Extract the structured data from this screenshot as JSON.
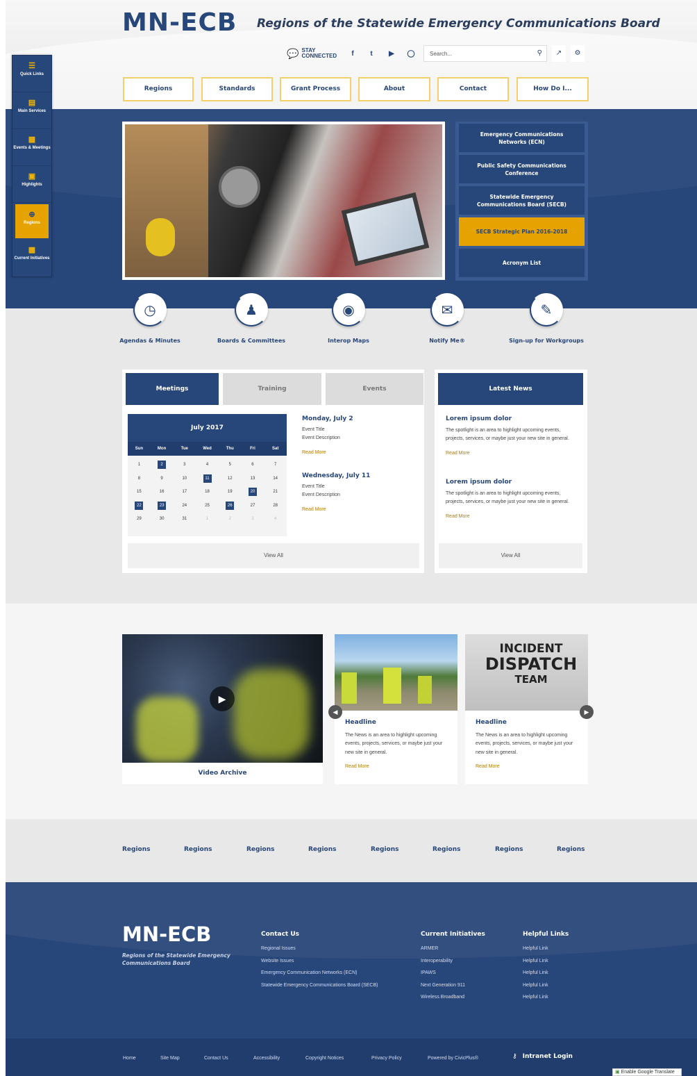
{
  "header": {
    "logo": "MN-ECB",
    "tagline": "Regions of the Statewide Emergency Communications Board",
    "stay_connected": [
      "STAY",
      "CONNECTED"
    ],
    "social": [
      "facebook-icon",
      "twitter-icon",
      "youtube-icon",
      "instagram-icon"
    ],
    "search_placeholder": "Search...",
    "nav": [
      "Regions",
      "Standards",
      "Grant Process",
      "About",
      "Contact",
      "How Do I..."
    ]
  },
  "sidebar": {
    "items": [
      {
        "label": "Quick Links",
        "icon": "list-icon"
      },
      {
        "label": "Main Services",
        "icon": "document-icon"
      },
      {
        "label": "Events & Meetings",
        "icon": "calendar-icon"
      },
      {
        "label": "Highlights",
        "icon": "image-icon"
      },
      {
        "label": "Regions",
        "icon": "globe-icon"
      },
      {
        "label": "Current Initiatives",
        "icon": "presentation-icon"
      }
    ]
  },
  "quick_links": [
    "Emergency Communications Networks (ECN)",
    "Public Safety Communications Conference",
    "Statewide Emergency Communications Board (SECB)",
    "SECB Strategic Plan 2016-2018",
    "Acronym List"
  ],
  "icon_links": [
    {
      "label": "Agendas & Minutes",
      "icon": "clock-icon"
    },
    {
      "label": "Boards & Committees",
      "icon": "people-icon"
    },
    {
      "label": "Interop Maps",
      "icon": "map-pin-icon"
    },
    {
      "label": "Notify Me®",
      "icon": "envelope-icon"
    },
    {
      "label": "Sign-up for Workgroups",
      "icon": "edit-icon"
    }
  ],
  "calendar": {
    "tabs": [
      "Meetings",
      "Training",
      "Events"
    ],
    "month": "July 2017",
    "weekdays": [
      "Sun",
      "Mon",
      "Tue",
      "Wed",
      "Thu",
      "Fri",
      "Sat"
    ],
    "weeks": [
      [
        "",
        "",
        "",
        "",
        "",
        "",
        ""
      ],
      [
        "1",
        "2",
        "3",
        "4",
        "5",
        "6",
        "7"
      ],
      [
        "8",
        "9",
        "10",
        "11",
        "12",
        "13",
        "14"
      ],
      [
        "15",
        "16",
        "17",
        "18",
        "19",
        "20",
        "21"
      ],
      [
        "22",
        "23",
        "24",
        "25",
        "26",
        "27",
        "28"
      ],
      [
        "29",
        "30",
        "31",
        "1",
        "2",
        "3",
        "4"
      ]
    ],
    "events": [
      {
        "date": "Monday, July 2",
        "title": "Event Title",
        "desc": "Event Description",
        "more": "Read More"
      },
      {
        "date": "Wednesday, July 11",
        "title": "Event Title",
        "desc": "Event Description",
        "more": "Read More"
      }
    ],
    "view_all": "View All"
  },
  "news": {
    "title": "Latest News",
    "items": [
      {
        "headline": "Lorem ipsum dolor",
        "text": "The spotlight is an area to highlight upcoming events, projects, services, or maybe just your new site in general.",
        "more": "Read More"
      },
      {
        "headline": "Lorem ipsum dolor",
        "text": "The spotlight is an area to highlight upcoming events, projects, services, or maybe just your new site in general.",
        "more": "Read More"
      }
    ],
    "view_all": "View All"
  },
  "media": {
    "video_label": "Video Archive",
    "cards": [
      {
        "headline": "Headline",
        "text": "The News is an area to highlight upcoming events, projects, services, or maybe just your new site in general.",
        "more": "Read More"
      },
      {
        "headline": "Headline",
        "text": "The News is an area to highlight upcoming events, projects, services, or maybe just your new site in general.",
        "more": "Read More",
        "image_text": [
          "INCIDENT",
          "DISPATCH",
          "TEAM"
        ]
      }
    ]
  },
  "regions": [
    "Regions",
    "Regions",
    "Regions",
    "Regions",
    "Regions",
    "Regions",
    "Regions",
    "Regions"
  ],
  "footer": {
    "logo": "MN-ECB",
    "subtitle": "Regions of the Statewide Emergency Communications Board",
    "columns": [
      {
        "title": "Contact Us",
        "items": [
          "Regional Issues",
          "Website Issues",
          "Emergency Communication Networks (ECN)",
          "Statewide Emergency Communications Board (SECB)"
        ]
      },
      {
        "title": "Current Initiatives",
        "items": [
          "ARMER",
          "Interoperability",
          "IPAWS",
          "Next Generation 911",
          "Wireless Broadband"
        ]
      },
      {
        "title": "Helpful Links",
        "items": [
          "Helpful Link",
          "Helpful Link",
          "Helpful Link",
          "Helpful Link",
          "Helpful Link"
        ]
      }
    ],
    "bottom_links": [
      "Home",
      "Site Map",
      "Contact Us",
      "Accessibility",
      "Copyright Notices",
      "Privacy Policy",
      "Powered by CivicPlus®"
    ],
    "intranet": "Intranet Login",
    "translate": "Enable Google Translate"
  },
  "colors": {
    "navy": "#27467a",
    "gold": "#e6a300",
    "gray": "#e8e8e8"
  }
}
